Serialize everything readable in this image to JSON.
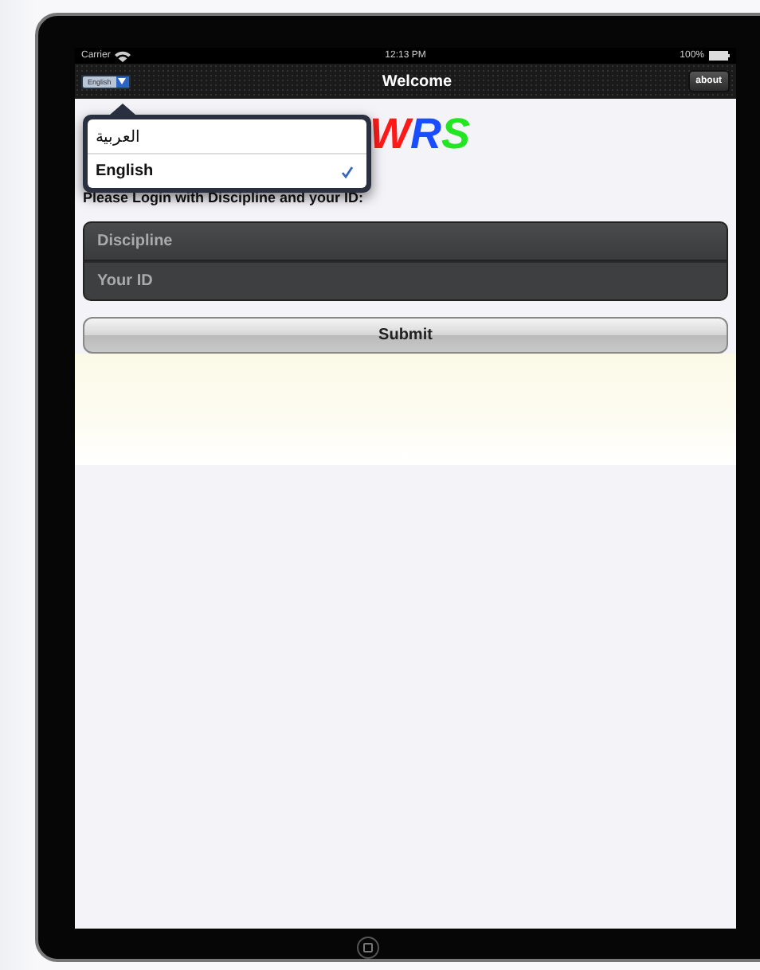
{
  "status_bar": {
    "carrier": "Carrier",
    "time": "12:13 PM",
    "battery": "100%"
  },
  "nav_bar": {
    "language_button": "English",
    "title": "Welcome",
    "about_button": "about"
  },
  "language_menu": {
    "options": [
      {
        "label": "العربية",
        "selected": false
      },
      {
        "label": "English",
        "selected": true
      }
    ]
  },
  "logo": {
    "letters": [
      {
        "text": "W",
        "color": "#ff1a1a"
      },
      {
        "text": "R",
        "color": "#1a4dff"
      },
      {
        "text": "S",
        "color": "#22e622"
      }
    ]
  },
  "instruction": "Please Login with Discipline and your ID:",
  "form": {
    "fields": [
      {
        "placeholder": "Discipline"
      },
      {
        "placeholder": "Your ID"
      }
    ],
    "submit": "Submit"
  }
}
